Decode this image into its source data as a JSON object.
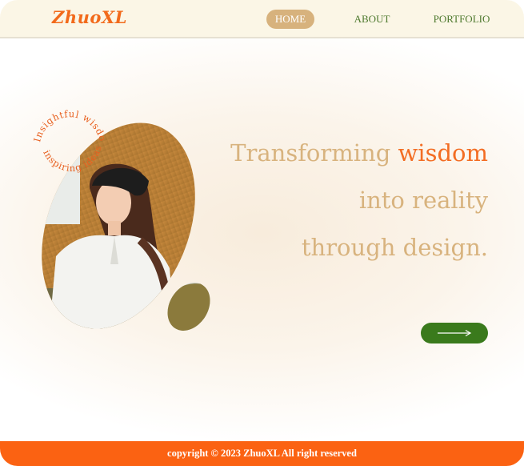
{
  "header": {
    "logo": "ZhuoXL",
    "nav": {
      "home": "HOME",
      "about": "ABOUT",
      "portfolio": "PORTFOLIO"
    }
  },
  "hero": {
    "line1_plain": "Transforming ",
    "line1_accent": "wisdom",
    "line2": "into reality",
    "line3": "through design.",
    "badge_text_top": "Insightful  wisdom",
    "badge_text_bottom": "inspiring  ideas",
    "cta_icon": "long-arrow-right-icon"
  },
  "footer": {
    "copyright": "copyright © 2023 ZhuoXL All right reserved"
  },
  "colors": {
    "brand_orange": "#f26a1b",
    "nav_green": "#4f7a2f",
    "nav_active_bg": "#d7b27d",
    "hero_text": "#d8b37e",
    "cta_green": "#3a7a1c",
    "footer_bg": "#fb6212"
  }
}
